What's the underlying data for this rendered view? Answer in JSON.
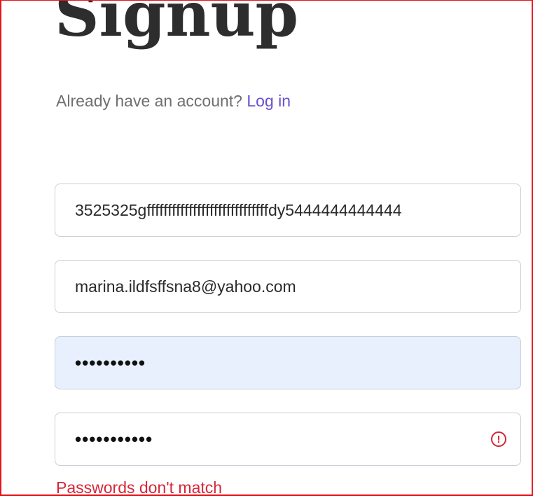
{
  "page": {
    "title": "Signup",
    "already_text": "Already have an account?",
    "login_label": "Log in"
  },
  "form": {
    "username_value": "3525325gfffffffffffffffffffffffffffffdy5444444444444",
    "email_value": "marina.ildfsffsna8@yahoo.com",
    "password_mask": "••••••••••",
    "confirm_password_mask": "•••••••••••",
    "error_icon": "alert-circle-icon",
    "error_message": "Passwords don't match"
  },
  "colors": {
    "highlight_border": "#e8141b",
    "link": "#6a4fcf",
    "error": "#d6263a",
    "autofill_background": "#e8f0fe"
  }
}
